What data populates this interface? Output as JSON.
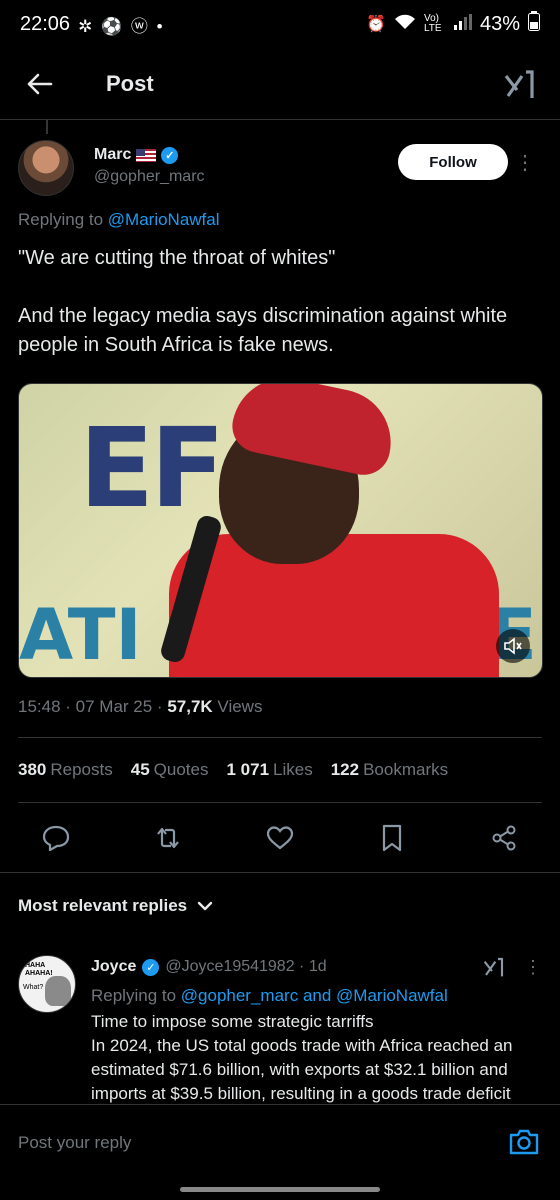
{
  "status_bar": {
    "time": "22:06",
    "notification_icons": "✲ ⚽ ⓦ •",
    "signal_text": "Vo) LTE",
    "battery": "43%"
  },
  "header": {
    "title": "Post"
  },
  "post": {
    "author_name": "Marc",
    "author_handle": "@gopher_marc",
    "follow_label": "Follow",
    "replying_prefix": "Replying to ",
    "replying_to": "@MarioNawfal",
    "text": "\"We are cutting the throat of whites\"\n\nAnd the legacy media says discrimination against white people in South Africa is fake news.",
    "media_text_1": "EF",
    "media_text_2": "ATI",
    "media_text_3": "E",
    "timestamp": "15:48 · 07 Mar 25 · ",
    "views_count": "57,7K",
    "views_label": " Views"
  },
  "stats": {
    "reposts_count": "380",
    "reposts_label": "Reposts",
    "quotes_count": "45",
    "quotes_label": "Quotes",
    "likes_count": "1 071",
    "likes_label": "Likes",
    "bookmarks_count": "122",
    "bookmarks_label": "Bookmarks"
  },
  "replies_section": {
    "title": "Most relevant replies"
  },
  "reply": {
    "name": "Joyce",
    "handle": "@Joyce19541982 · 1d",
    "replying_prefix": "Replying to ",
    "replying_to_1": "@gopher_marc",
    "replying_and": " and ",
    "replying_to_2": "@MarioNawfal",
    "text": "Time to impose some strategic tarriffs\nIn 2024, the US total goods trade with Africa reached an estimated $71.6 billion, with exports at $32.1 billion and imports at $39.5 billion, resulting in a goods trade deficit",
    "avatar_text_1": "HAHA\nAHAHA!",
    "avatar_text_2": "What?"
  },
  "composer": {
    "placeholder": "Post your reply"
  },
  "colors": {
    "accent": "#1d9bf0",
    "background": "#000000",
    "text_primary": "#e7e9ea",
    "text_secondary": "#71767b"
  },
  "icons": {
    "back": "arrow-left-icon",
    "grok": "grok-icon",
    "verified": "verified-badge-icon",
    "more": "more-vertical-icon",
    "mute": "volume-muted-icon",
    "reply": "reply-icon",
    "repost": "repost-icon",
    "like": "heart-icon",
    "bookmark": "bookmark-icon",
    "share": "share-icon",
    "chevron": "chevron-down-icon",
    "camera": "camera-icon"
  }
}
